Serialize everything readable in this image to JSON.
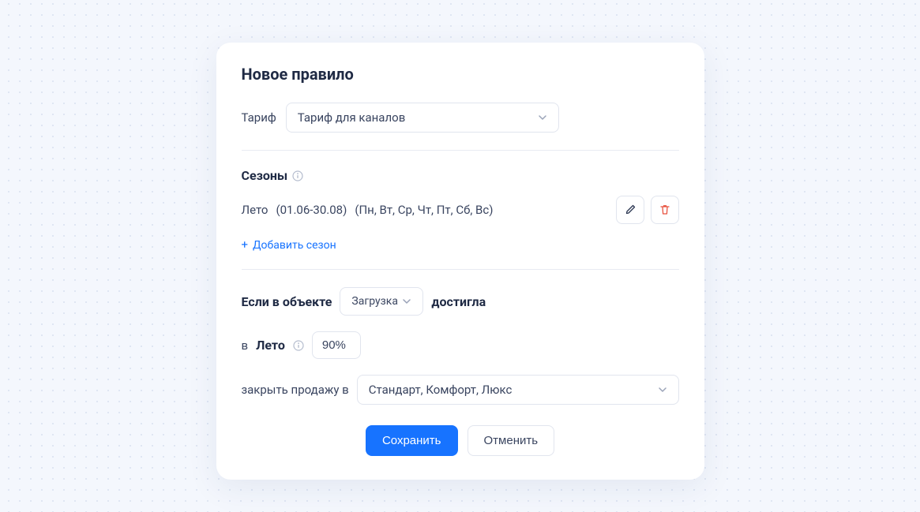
{
  "title": "Новое правило",
  "tariff": {
    "label": "Тариф",
    "selected": "Тариф для каналов"
  },
  "seasons": {
    "title": "Сезоны",
    "items": [
      {
        "name": "Лето",
        "dates": "(01.06-30.08)",
        "days": "(Пн, Вт, Ср, Чт, Пт, Сб, Вс)"
      }
    ],
    "add_label": "Добавить сезон"
  },
  "condition": {
    "prefix": "Если в объекте",
    "metric": "Загрузка",
    "reached": "достигла",
    "in_prefix": "в",
    "season_name": "Лето",
    "threshold": "90%",
    "close_prefix": "закрыть продажу в",
    "rooms": "Стандарт, Комфорт, Люкс"
  },
  "actions": {
    "save": "Сохранить",
    "cancel": "Отменить"
  }
}
